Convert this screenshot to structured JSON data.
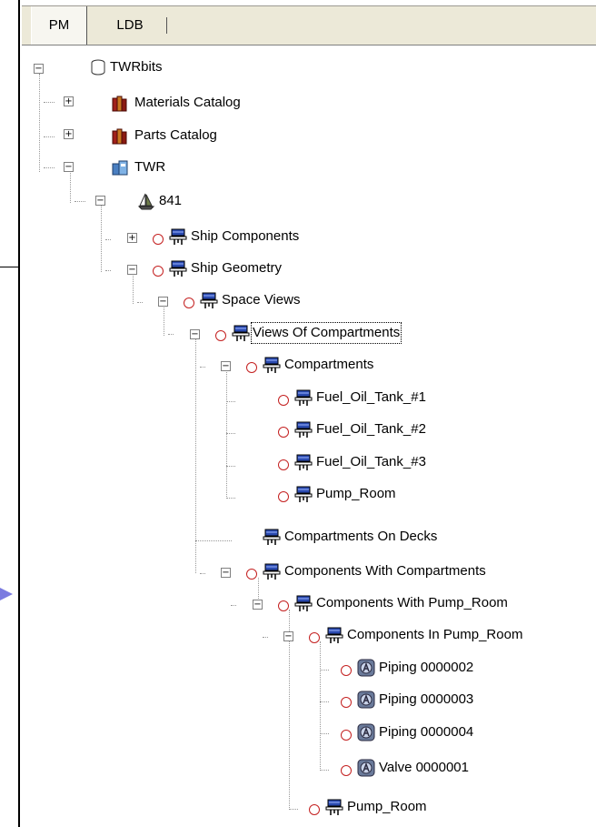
{
  "tabs": [
    {
      "label": "PM",
      "active": true
    },
    {
      "label": "LDB",
      "active": false
    }
  ],
  "tree": {
    "root": "TWRbits",
    "materials_catalog": "Materials Catalog",
    "parts_catalog": "Parts Catalog",
    "twr": "TWR",
    "n841": "841",
    "ship_components": "Ship Components",
    "ship_geometry": "Ship Geometry",
    "space_views": "Space Views",
    "views_of_compartments": "Views Of Compartments",
    "compartments": "Compartments",
    "fuel_oil_tank_1": "Fuel_Oil_Tank_#1",
    "fuel_oil_tank_2": "Fuel_Oil_Tank_#2",
    "fuel_oil_tank_3": "Fuel_Oil_Tank_#3",
    "pump_room_1": "Pump_Room",
    "compartments_on_decks": "Compartments On Decks",
    "components_with_compartments": "Components With Compartments",
    "components_with_pump_room": "Components With Pump_Room",
    "components_in_pump_room": "Components In Pump_Room",
    "piping_2": "Piping 0000002",
    "piping_3": "Piping 0000003",
    "piping_4": "Piping 0000004",
    "valve_1": "Valve 0000001",
    "pump_room_2": "Pump_Room"
  },
  "expander_glyphs": {
    "collapsed": "+",
    "expanded": "−"
  },
  "colors": {
    "status_circle": "#c42020",
    "tab_bar": "#ece9d8",
    "tree_lines": "#999999"
  }
}
